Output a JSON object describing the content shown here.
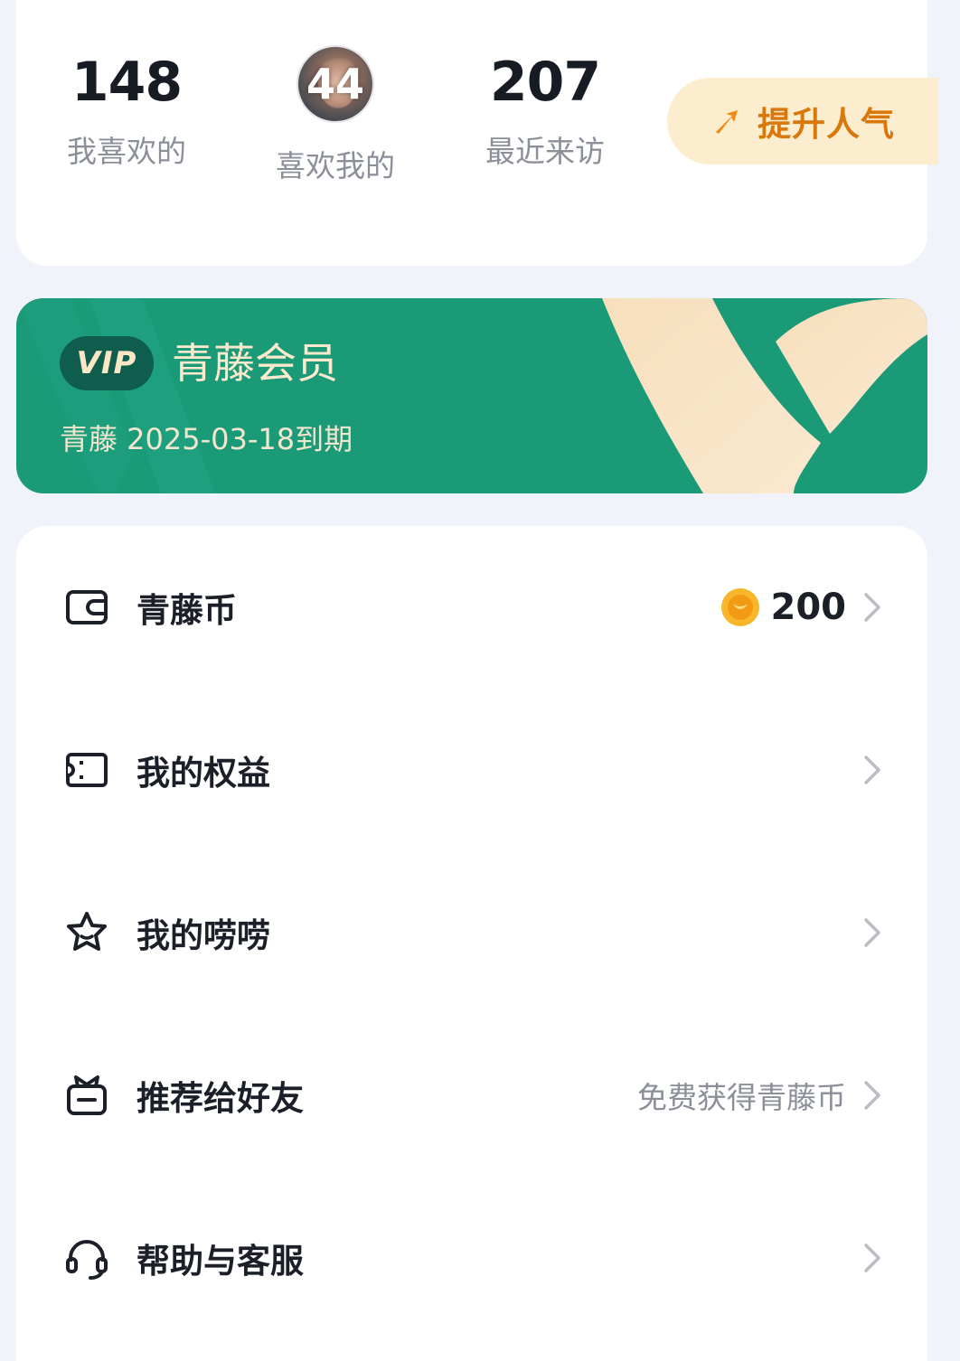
{
  "stats": {
    "liked": {
      "value": "148",
      "label": "我喜欢的"
    },
    "liked_me": {
      "value": "44",
      "label": "喜欢我的"
    },
    "visitors": {
      "value": "207",
      "label": "最近来访"
    }
  },
  "boost": {
    "label": "提升人气",
    "icon": "arrow-up-icon"
  },
  "vip": {
    "badge": "VIP",
    "title": "青藤会员",
    "expiry": "青藤 2025-03-18到期",
    "colors": {
      "background": "#1b9a78",
      "accent": "#fbe6c6"
    }
  },
  "menu": {
    "items": [
      {
        "label": "青藤币",
        "icon": "wallet-icon",
        "value": "200",
        "value_icon": "coin-icon"
      },
      {
        "label": "我的权益",
        "icon": "ticket-icon"
      },
      {
        "label": "我的唠唠",
        "icon": "star-icon"
      },
      {
        "label": "推荐给好友",
        "icon": "gift-icon",
        "hint": "免费获得青藤币"
      },
      {
        "label": "帮助与客服",
        "icon": "headset-icon"
      }
    ]
  }
}
